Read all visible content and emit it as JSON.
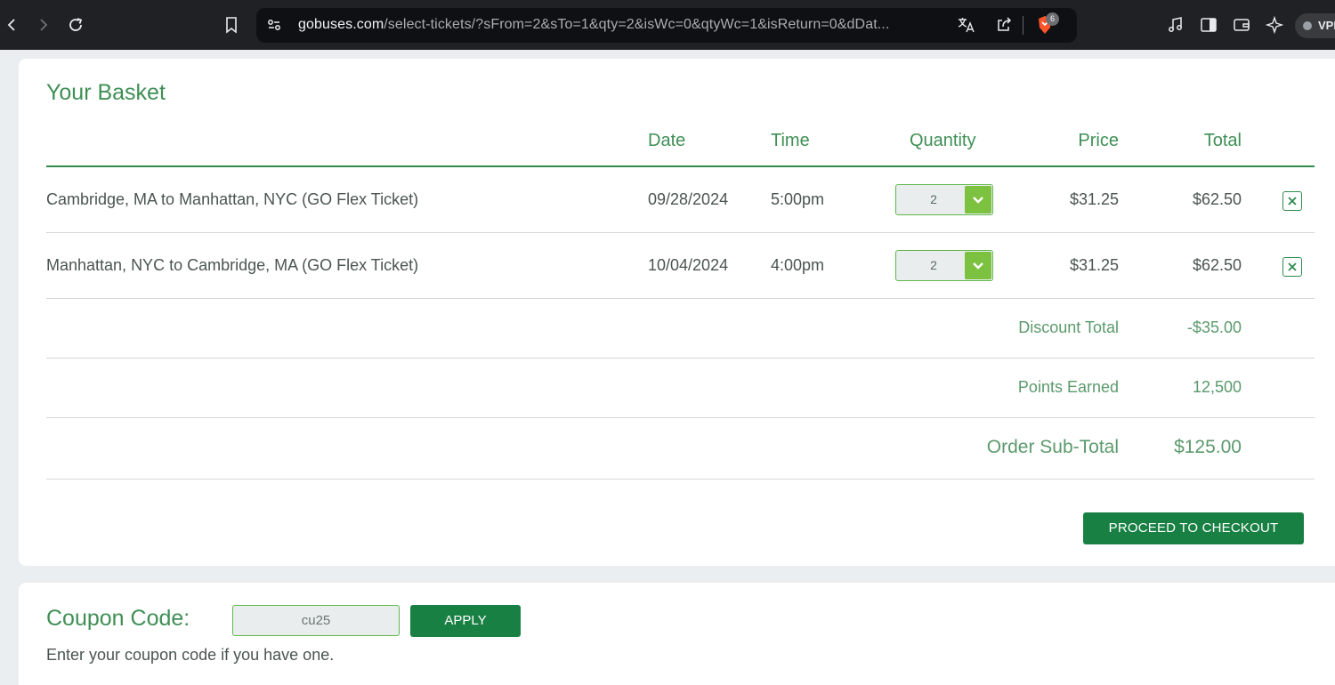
{
  "browser": {
    "url_host": "gobuses.com",
    "url_path": "/select-tickets/?sFrom=2&sTo=1&qty=2&isWc=0&qtyWc=1&isReturn=0&dDat...",
    "shields_count": "6",
    "vpn_label": "VPN",
    "icons": [
      "back-icon",
      "forward-icon",
      "reload-icon",
      "bookmark-icon",
      "site-settings-icon",
      "translate-icon",
      "share-icon",
      "brave-shields-icon",
      "music-icon",
      "sidebar-icon",
      "wallet-icon",
      "leo-ai-icon"
    ]
  },
  "basket": {
    "title": "Your Basket",
    "columns": {
      "date": "Date",
      "time": "Time",
      "quantity": "Quantity",
      "price": "Price",
      "total": "Total"
    },
    "rows": [
      {
        "description": "Cambridge, MA to Manhattan, NYC (GO Flex Ticket)",
        "date": "09/28/2024",
        "time": "5:00pm",
        "quantity": "2",
        "price": "$31.25",
        "total": "$62.50"
      },
      {
        "description": "Manhattan, NYC to Cambridge, MA (GO Flex Ticket)",
        "date": "10/04/2024",
        "time": "4:00pm",
        "quantity": "2",
        "price": "$31.25",
        "total": "$62.50"
      }
    ],
    "discount_label": "Discount Total",
    "discount_value": "-$35.00",
    "points_label": "Points Earned",
    "points_value": "12,500",
    "subtotal_label": "Order Sub-Total",
    "subtotal_value": "$125.00",
    "checkout_label": "PROCEED TO CHECKOUT"
  },
  "coupon": {
    "title": "Coupon Code:",
    "value": "cu25",
    "apply_label": "APPLY",
    "help_text": "Enter your coupon code if you have one."
  },
  "colors": {
    "brand_green": "#198044",
    "heading_green": "#3f8f55",
    "qty_button_green": "#7cc140"
  }
}
